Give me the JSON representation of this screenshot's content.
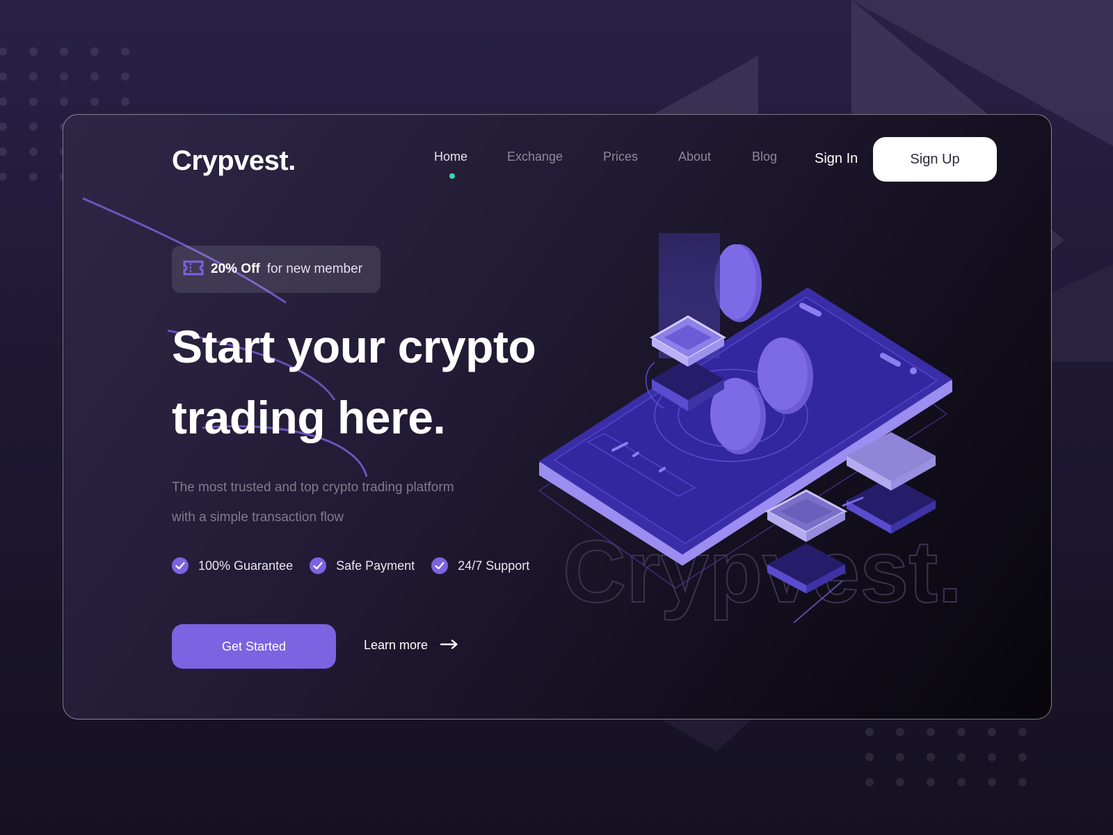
{
  "brand": {
    "logo": "Crypvest.",
    "watermark": "Crypvest."
  },
  "nav": {
    "items": [
      {
        "label": "Home",
        "active": true
      },
      {
        "label": "Exchange",
        "active": false
      },
      {
        "label": "Prices",
        "active": false
      },
      {
        "label": "About",
        "active": false
      },
      {
        "label": "Blog",
        "active": false
      }
    ],
    "sign_in": "Sign In",
    "sign_up": "Sign Up"
  },
  "promo": {
    "icon": "ticket-icon",
    "highlight": "20% Off",
    "text": "for new member"
  },
  "hero": {
    "title_line1": "Start your crypto",
    "title_line2": "trading here.",
    "subtitle_line1": "The most trusted and top crypto trading platform",
    "subtitle_line2": "with a simple transaction flow"
  },
  "features": [
    {
      "icon": "check-icon",
      "label": "100% Guarantee"
    },
    {
      "icon": "check-icon",
      "label": "Safe Payment"
    },
    {
      "icon": "check-icon",
      "label": "24/7 Support"
    }
  ],
  "cta": {
    "primary": "Get Started",
    "secondary": "Learn more",
    "secondary_icon": "arrow-right-icon"
  },
  "colors": {
    "accent": "#7b63e2",
    "active_dot": "#39d6b0",
    "background": "#221b35",
    "text_muted": "#8d8898"
  }
}
